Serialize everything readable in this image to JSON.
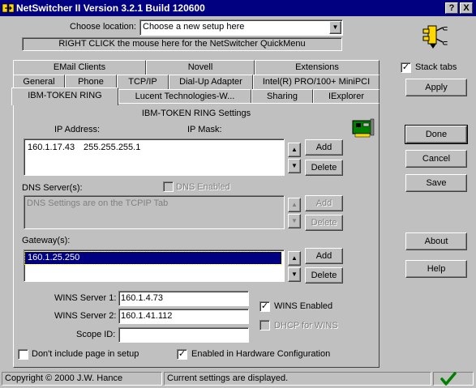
{
  "window": {
    "title": "NetSwitcher II Version 3.2.1 Build 120600",
    "help_button": "?",
    "close_button": "X"
  },
  "location": {
    "label": "Choose location:",
    "selected": "Choose a new setup here"
  },
  "quickmenu_hint": "RIGHT CLICK the mouse here for the NetSwitcher QuickMenu",
  "tabs": {
    "row1": [
      "EMail Clients",
      "Novell",
      "Extensions"
    ],
    "row2": [
      "General",
      "Phone",
      "TCP/IP",
      "Dial-Up Adapter",
      "Intel(R) PRO/100+ MiniPCI"
    ],
    "row3": [
      "IBM-TOKEN RING",
      "Lucent Technologies-W...",
      "Sharing",
      "IExplorer"
    ]
  },
  "panel": {
    "title": "IBM-TOKEN RING Settings",
    "ip_label": "IP Address:",
    "mask_label": "IP Mask:",
    "ip_rows": [
      {
        "ip": "160.1.17.43",
        "mask": "255.255.255.1"
      }
    ],
    "dns_label": "DNS Server(s):",
    "dns_enabled_label": "DNS Enabled",
    "dns_text": "DNS Settings are on the TCPIP Tab",
    "gateway_label": "Gateway(s):",
    "gateways": [
      "160.1.25.250"
    ],
    "wins1_label": "WINS Server 1:",
    "wins1_value": "160.1.4.73",
    "wins2_label": "WINS Server 2:",
    "wins2_value": "160.1.41.112",
    "scope_label": "Scope ID:",
    "scope_value": "",
    "wins_enabled_label": "WINS Enabled",
    "dhcp_wins_label": "DHCP for WINS",
    "dont_include_label": "Don't include page in setup",
    "enabled_hw_label": "Enabled in Hardware Configuration",
    "add_label": "Add",
    "delete_label": "Delete",
    "up_arrow": "▲",
    "down_arrow": "▼"
  },
  "side": {
    "stack_tabs_label": "Stack tabs",
    "apply": "Apply",
    "done": "Done",
    "cancel": "Cancel",
    "save": "Save",
    "about": "About",
    "help": "Help"
  },
  "checks": {
    "stack_tabs": true,
    "dns_enabled": false,
    "wins_enabled": true,
    "dhcp_wins": false,
    "dont_include": false,
    "enabled_hw": true,
    "check_mark": "✓"
  },
  "status": {
    "copyright": "Copyright © 2000 J.W. Hance",
    "message": "Current settings are displayed."
  },
  "colors": {
    "titlebar": "#000080",
    "selection": "#000080",
    "face": "#c0c0c0",
    "ok_check": "#008000"
  }
}
